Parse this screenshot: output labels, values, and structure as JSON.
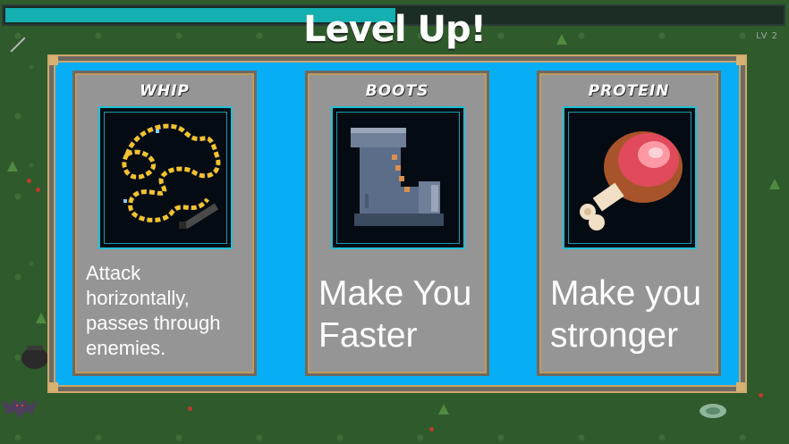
{
  "hud": {
    "xp_progress": 0.505,
    "level_label": "LV 2",
    "title": "Level Up!"
  },
  "cards": [
    {
      "name": "WHIP",
      "icon": "whip-icon",
      "description": "Attack horizontally, passes through enemies."
    },
    {
      "name": "BOOTS",
      "icon": "boots-icon",
      "description": "Make You Faster"
    },
    {
      "name": "PROTEIN",
      "icon": "meat-icon",
      "description": "Make you stronger"
    }
  ],
  "colors": {
    "xp_fill": "#14afb0",
    "panel": "#07aef5",
    "card": "#959595",
    "grass": "#2f5a2c"
  }
}
